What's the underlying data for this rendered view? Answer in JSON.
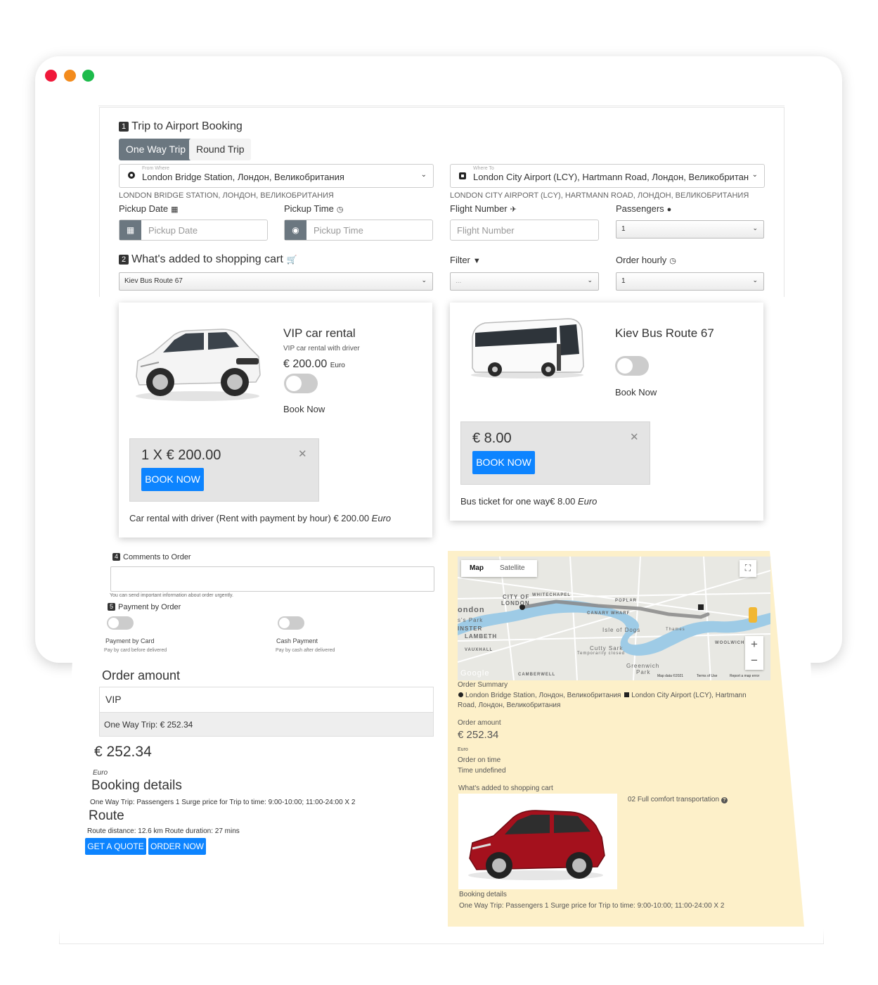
{
  "window": {
    "traffic_lights": [
      "#f0183a",
      "#f38b1c",
      "#1dbb4b"
    ]
  },
  "step1": {
    "number": "1",
    "title": "Trip to Airport Booking",
    "tabs": [
      {
        "label": "One Way Trip",
        "active": true
      },
      {
        "label": "Round Trip",
        "active": false
      }
    ],
    "from": {
      "tiny_label": "From Where",
      "value": "London Bridge Station, Лондон, Великобритания",
      "caption": "LONDON BRIDGE STATION, ЛОНДОН, ВЕЛИКОБРИТАНИЯ"
    },
    "to": {
      "tiny_label": "Where To",
      "value": "London City Airport (LCY), Hartmann Road, Лондон, Великобритан",
      "caption": "LONDON CITY AIRPORT (LCY), HARTMANN ROAD, ЛОНДОН, ВЕЛИКОБРИТАНИЯ"
    },
    "pickup_date": {
      "label": "Pickup Date",
      "placeholder": "Pickup Date",
      "icon": "calendar-icon"
    },
    "pickup_time": {
      "label": "Pickup Time",
      "placeholder": "Pickup Time",
      "icon": "clock-icon"
    },
    "flight_number": {
      "label": "Flight Number",
      "placeholder": "Flight Number",
      "icon": "plane-icon"
    },
    "passengers": {
      "label": "Passengers",
      "value": "1",
      "icon": "user-icon"
    }
  },
  "step2": {
    "number": "2",
    "title": "What's added to shopping cart",
    "cart_select": "Kiev Bus Route 67",
    "filter": {
      "label": "Filter",
      "value": "..."
    },
    "order_hourly": {
      "label": "Order hourly",
      "value": "1"
    }
  },
  "vip_card": {
    "title": "VIP car rental",
    "subtitle": "VIP car rental with driver",
    "price": "€ 200.00",
    "currency": "Euro",
    "book_label": "Book Now",
    "quote_price": "1 X € 200.00",
    "button": "BOOK NOW",
    "desc_main": "Car rental with driver (Rent with payment by hour) € 200.00",
    "desc_unit": "Euro"
  },
  "bus_card": {
    "title": "Kiev Bus Route 67",
    "book_label": "Book Now",
    "quote_price": "€ 8.00",
    "button": "BOOK NOW",
    "desc_main": "Bus ticket for one way€ 8.00",
    "desc_unit": "Euro"
  },
  "step4": {
    "number": "4",
    "title": "Comments to Order",
    "note": "You can send important information about order urgently."
  },
  "step5": {
    "number": "5",
    "title": "Payment by Order",
    "options": [
      {
        "label": "Payment by Card",
        "sub": "Pay by card before delivered"
      },
      {
        "label": "Cash Payment",
        "sub": "Pay by cash after delivered"
      }
    ]
  },
  "order": {
    "heading": "Order amount",
    "row1": "VIP",
    "row2": "One Way Trip: € 252.34",
    "total": "€ 252.34",
    "currency": "Euro",
    "booking_heading": "Booking details",
    "booking_text": "One Way Trip: Passengers 1 Surge price for Trip to time: 9:00-10:00; 11:00-24:00 X 2",
    "route_heading": "Route",
    "route_text": "Route distance: 12.6 km Route duration: 27 mins",
    "btn_quote": "GET A QUOTE",
    "btn_order": "ORDER NOW"
  },
  "map": {
    "tab_map": "Map",
    "tab_satellite": "Satellite",
    "labels": {
      "city_of": "CITY OF",
      "london_short": "LONDON",
      "ondon": "ondon",
      "park": "s's Park",
      "minster": "INSTER",
      "lambeth": "LAMBETH",
      "vauxhall": "VAUXHALL",
      "whitechapel": "WHITECHAPEL",
      "poplar": "POPLAR",
      "canary": "CANARY WHARF",
      "isle": "Isle of Dogs",
      "thames": "Thames",
      "woolwich": "WOOLWICH",
      "cutty": "Cutty Sark",
      "cutty_sub": "Temporarily closed",
      "greenwich": "Greenwich",
      "greenwich_park": "Park",
      "camberwell": "CAMBERWELL",
      "google": "Google"
    },
    "footer_data": "Map data ©2021",
    "footer_terms": "Terms of Use",
    "footer_report": "Report a map error",
    "zoom_in": "+",
    "zoom_out": "−"
  },
  "summary": {
    "order_summary": "Order Summary",
    "route_from": "London Bridge Station, Лондон, Великобритания",
    "route_to_1": "London City Airport (LCY), Hartmann",
    "route_to_2": "Road, Лондон, Великобритания",
    "amount_label": "Order amount",
    "amount": "€ 252.34",
    "currency": "Euro",
    "time_label": "Order on time",
    "time_value": "Time undefined",
    "cart_label": "What's added to shopping cart",
    "cart_item": "02 Full comfort transportation",
    "booking_label": "Booking details",
    "booking_text": "One Way Trip: Passengers 1 Surge price for Trip to time: 9:00-10:00; 11:00-24:00 X 2"
  }
}
